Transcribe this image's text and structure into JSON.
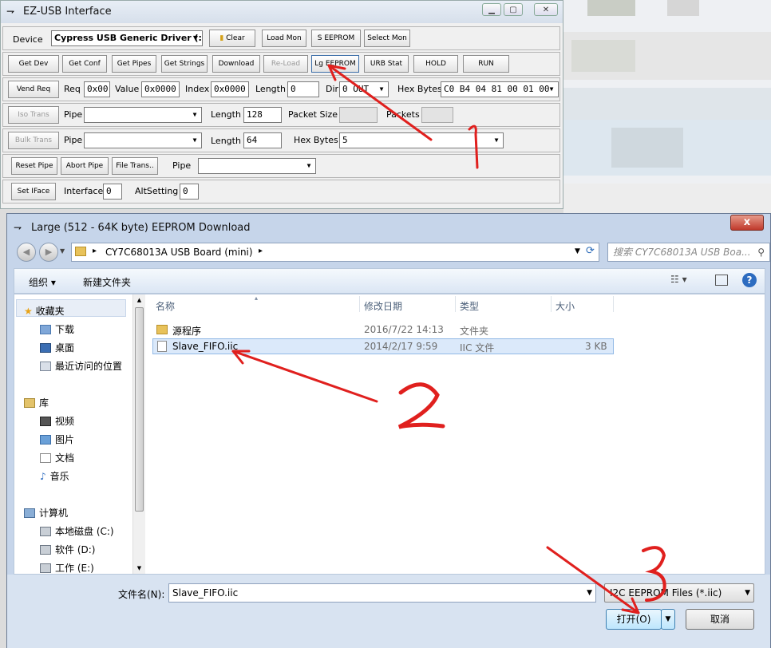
{
  "ez_window": {
    "title": "EZ-USB Interface",
    "device_label": "Device",
    "device_value": "Cypress USB Generic Driver (:",
    "row1_buttons": [
      "Clear",
      "Load Mon",
      "S EEPROM",
      "Select Mon"
    ],
    "row2_buttons": [
      "Get Dev",
      "Get Conf",
      "Get Pipes",
      "Get Strings",
      "Download",
      "Re-Load",
      "Lg EEPROM",
      "URB Stat",
      "HOLD",
      "RUN"
    ],
    "vend_req": {
      "button": "Vend Req",
      "req_label": "Req",
      "req_value": "0x00",
      "value_label": "Value",
      "value_value": "0x0000",
      "index_label": "Index",
      "index_value": "0x0000",
      "length_label": "Length",
      "length_value": "0",
      "dir_label": "Dir",
      "dir_value": "0 OUT",
      "hex_label": "Hex Bytes",
      "hex_value": "C0 B4 04 81 00 01 00"
    },
    "iso": {
      "button": "Iso Trans",
      "pipe_label": "Pipe",
      "length_label": "Length",
      "length_value": "128",
      "packet_size_label": "Packet Size",
      "packets_label": "Packets"
    },
    "bulk": {
      "button": "Bulk Trans",
      "pipe_label": "Pipe",
      "length_label": "Length",
      "length_value": "64",
      "hex_label": "Hex Bytes",
      "hex_value": "5"
    },
    "pipe_row": {
      "buttons": [
        "Reset Pipe",
        "Abort Pipe",
        "File Trans.."
      ],
      "pipe_label": "Pipe"
    },
    "iface_row": {
      "button": "Set IFace",
      "interface_label": "Interface",
      "interface_value": "0",
      "alt_label": "AltSetting",
      "alt_value": "0"
    }
  },
  "dialog": {
    "title": "Large (512 - 64K byte) EEPROM Download",
    "close": "x",
    "address_path": "CY7C68013A USB Board (mini)",
    "search_placeholder": "搜索 CY7C68013A USB Boa...",
    "toolbar": {
      "organize": "组织 ▾",
      "new_folder": "新建文件夹"
    },
    "nav": {
      "favorites": "收藏夹",
      "downloads": "下载",
      "desktop": "桌面",
      "recent": "最近访问的位置",
      "libraries": "库",
      "videos": "视频",
      "pictures": "图片",
      "documents": "文档",
      "music": "音乐",
      "computer": "计算机",
      "disk_c": "本地磁盘 (C:)",
      "disk_d": "软件 (D:)",
      "disk_e": "工作 (E:)"
    },
    "columns": [
      "名称",
      "修改日期",
      "类型",
      "大小"
    ],
    "files": [
      {
        "name": "源程序",
        "date": "2016/7/22 14:13",
        "type": "文件夹",
        "size": ""
      },
      {
        "name": "Slave_FIFO.iic",
        "date": "2014/2/17 9:59",
        "type": "IIC 文件",
        "size": "3 KB"
      }
    ],
    "filename_label": "文件名(N):",
    "filename_value": "Slave_FIFO.iic",
    "filetype_value": "I2C EEPROM Files (*.iic)",
    "open_button": "打开(O)",
    "cancel_button": "取消"
  },
  "annotation_color": "#e0201e"
}
